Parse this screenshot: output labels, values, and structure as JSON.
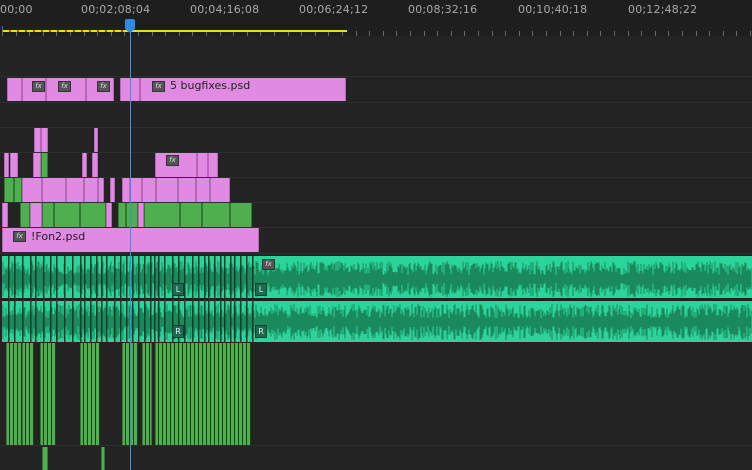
{
  "ruler": {
    "timecodes": [
      "00;00",
      "00;02;08;04",
      "00;04;16;08",
      "00;06;24;12",
      "00;08;32;16",
      "00;10;40;18",
      "00;12;48;22"
    ]
  },
  "clips": {
    "bugfixes": {
      "name": "5 bugfixes.psd"
    },
    "fon2": {
      "name": "!Fon2.psd"
    }
  },
  "fx_label": "fx",
  "audio": {
    "left_label": "L",
    "right_label": "R"
  },
  "colors": {
    "pink_clip": "#e08ae3",
    "green_clip": "#4fae4f",
    "audio_clip": "#2ad49a",
    "playhead": "#2f8ae3",
    "work_area": "#e6e020"
  }
}
